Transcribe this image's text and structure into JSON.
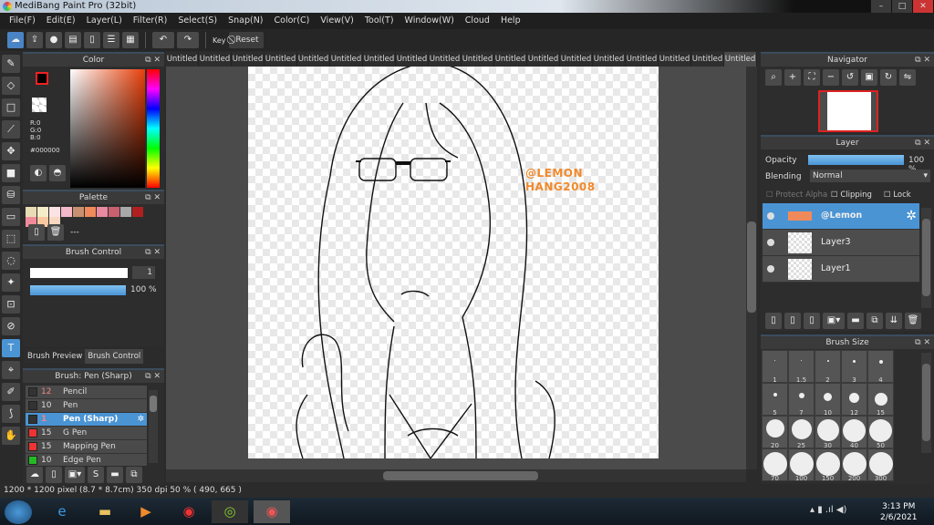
{
  "window": {
    "title": "MediBang Paint Pro (32bit)",
    "min": "–",
    "max": "□",
    "close": "✕"
  },
  "menu": [
    "File(F)",
    "Edit(E)",
    "Layer(L)",
    "Filter(R)",
    "Select(S)",
    "Snap(N)",
    "Color(C)",
    "View(V)",
    "Tool(T)",
    "Window(W)",
    "Cloud",
    "Help"
  ],
  "toolbar": {
    "key_label": "Key",
    "reset_label": "Reset"
  },
  "color_panel": {
    "title": "Color",
    "r": "R:0",
    "g": "G:0",
    "b": "B:0",
    "hex": "#000000",
    "primary": "#000000",
    "secondary": "#2a1010"
  },
  "palette": {
    "title": "Palette",
    "swatches": [
      "#e8dcb5",
      "#f5ecc8",
      "#fbe3e3",
      "#f5b8c8",
      "#c89070",
      "#f08a5a",
      "#e88aa0",
      "#c86070",
      "#a8a8a8",
      "#b02020",
      "#f08a9a",
      "#f8c8a0",
      "#f8d8c0"
    ],
    "text": "---"
  },
  "brush_control": {
    "title": "Brush Control",
    "size": "1",
    "opacity": "100 %",
    "opacity_value": 100
  },
  "brush_tabs": [
    "Brush Preview",
    "Brush Control"
  ],
  "brush_list": {
    "title": "Brush: Pen (Sharp)",
    "items": [
      {
        "size": "12",
        "name": "Pencil",
        "color": "#333333"
      },
      {
        "size": "10",
        "name": "Pen",
        "color": "#333333"
      },
      {
        "size": "1",
        "name": "Pen (Sharp)",
        "color": "#333333",
        "selected": true
      },
      {
        "size": "15",
        "name": "G Pen",
        "color": "#ee3333"
      },
      {
        "size": "15",
        "name": "Mapping Pen",
        "color": "#ee3333"
      },
      {
        "size": "10",
        "name": "Edge Pen",
        "color": "#22bb22"
      }
    ]
  },
  "canvas_tabs": [
    "Untitled",
    "Untitled",
    "Untitled",
    "Untitled",
    "Untitled",
    "Untitled",
    "Untitled",
    "Untitled",
    "Untitled",
    "Untitled",
    "Untitled",
    "Untitled",
    "Untitled",
    "Untitled",
    "Untitled",
    "Untitled",
    "Untitled",
    "Untitled"
  ],
  "canvas": {
    "watermark_line1": "@LEMON",
    "watermark_line2": "HANG2008",
    "watermark_color": "#f08a2c"
  },
  "navigator": {
    "title": "Navigator"
  },
  "layer_panel": {
    "title": "Layer",
    "opacity_label": "Opacity",
    "opacity": "100 %",
    "opacity_value": 100,
    "blending_label": "Blending",
    "blending": "Normal",
    "protect_alpha": "Protect Alpha",
    "clipping": "Clipping",
    "lock": "Lock",
    "layers": [
      {
        "name": "@Lemon",
        "selected": true
      },
      {
        "name": "Layer3"
      },
      {
        "name": "Layer1"
      }
    ]
  },
  "brush_size": {
    "title": "Brush Size",
    "sizes": [
      "1",
      "1.5",
      "2",
      "3",
      "4",
      "5",
      "7",
      "10",
      "12",
      "15",
      "20",
      "25",
      "30",
      "40",
      "50",
      "70",
      "100",
      "150",
      "200",
      "300"
    ]
  },
  "status": "1200 * 1200 pixel   (8.7 * 8.7cm)   350 dpi   50 %   ( 490, 665 )",
  "clock": {
    "time": "3:13 PM",
    "date": "2/6/2021"
  }
}
